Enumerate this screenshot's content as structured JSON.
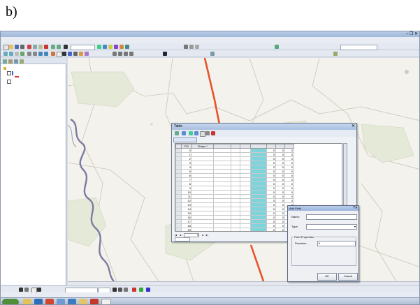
{
  "caption": "b)",
  "window": {
    "title": "",
    "buttons": "– ❐ ✕"
  },
  "menu": [
    "",
    "",
    "",
    "",
    "",
    "",
    "",
    "",
    "",
    ""
  ],
  "toolbar": {
    "scale_value": "",
    "editor_label": "",
    "layer_select": ""
  },
  "toc": {
    "items": [
      {
        "label": ""
      },
      {
        "label": ""
      },
      {
        "label": ""
      }
    ]
  },
  "table_window": {
    "title": "Table",
    "tab_label": "",
    "columns": [
      "FID",
      "Shape *",
      "",
      "",
      "",
      "",
      "",
      "",
      ""
    ],
    "rows": [
      [
        "0",
        "",
        "",
        "",
        "",
        "",
        "0",
        "0",
        "0"
      ],
      [
        "1",
        "",
        "",
        "",
        "",
        "",
        "0",
        "0",
        "0"
      ],
      [
        "2",
        "",
        "",
        "",
        "",
        "",
        "0",
        "0",
        "0"
      ],
      [
        "3",
        "",
        "",
        "",
        "",
        "",
        "0",
        "0",
        "0"
      ],
      [
        "4",
        "",
        "",
        "",
        "",
        "",
        "0",
        "0",
        "0"
      ],
      [
        "5",
        "",
        "",
        "",
        "",
        "",
        "0",
        "0",
        "0"
      ],
      [
        "6",
        "",
        "",
        "",
        "",
        "",
        "0",
        "0",
        "0"
      ],
      [
        "7",
        "",
        "",
        "",
        "",
        "",
        "0",
        "0",
        "0"
      ],
      [
        "8",
        "",
        "",
        "",
        "",
        "",
        "0",
        "0",
        "0"
      ],
      [
        "9",
        "",
        "",
        "",
        "",
        "",
        "0",
        "0",
        "0"
      ],
      [
        "10",
        "",
        "",
        "",
        "",
        "",
        "0",
        "0",
        "0"
      ],
      [
        "11",
        "",
        "",
        "",
        "",
        "",
        "0",
        "0",
        "0"
      ],
      [
        "12",
        "",
        "",
        "",
        "",
        "",
        "0",
        "0",
        "0"
      ],
      [
        "13",
        "",
        "",
        "",
        "",
        "",
        "0",
        "0",
        "0"
      ],
      [
        "14",
        "",
        "",
        "",
        "",
        "",
        "0",
        "0",
        "0"
      ],
      [
        "15",
        "",
        "",
        "",
        "",
        "",
        "0",
        "0",
        "0"
      ],
      [
        "16",
        "",
        "",
        "",
        "",
        "",
        "0",
        "0",
        "0"
      ],
      [
        "17",
        "",
        "",
        "",
        "",
        "",
        "0",
        "0",
        "0"
      ],
      [
        "18",
        "",
        "",
        "",
        "",
        "",
        "0",
        "0",
        "0"
      ],
      [
        "19",
        "",
        "",
        "",
        "",
        "",
        "0",
        "0",
        "0"
      ],
      [
        "20",
        "",
        "",
        "",
        "",
        "",
        "0",
        "0",
        "0"
      ],
      [
        "21",
        "",
        "",
        "",
        "",
        "",
        "0",
        "0",
        "0"
      ],
      [
        "22",
        "",
        "",
        "",
        "",
        "",
        "0",
        "0",
        "0"
      ],
      [
        "23",
        "",
        "",
        "",
        "",
        "",
        "0",
        "0",
        "0"
      ]
    ],
    "nav_record": "0",
    "selection_text": "",
    "bottom_tab": ""
  },
  "add_field": {
    "title": "Add Field",
    "name_label": "Name:",
    "name_value": "",
    "type_label": "Type:",
    "type_value": "",
    "props_label": "Field Properties",
    "precision_label": "Precision",
    "precision_value": "0",
    "ok": "OK",
    "cancel": "Cancel"
  },
  "status": {
    "coords": ""
  },
  "drawing": {
    "label": "",
    "font": ""
  },
  "taskbar": {
    "start": "",
    "clock": ""
  },
  "colors": {
    "river": "#7b7ba3",
    "road": "#e8532b",
    "highlight": "#7fd3da"
  }
}
